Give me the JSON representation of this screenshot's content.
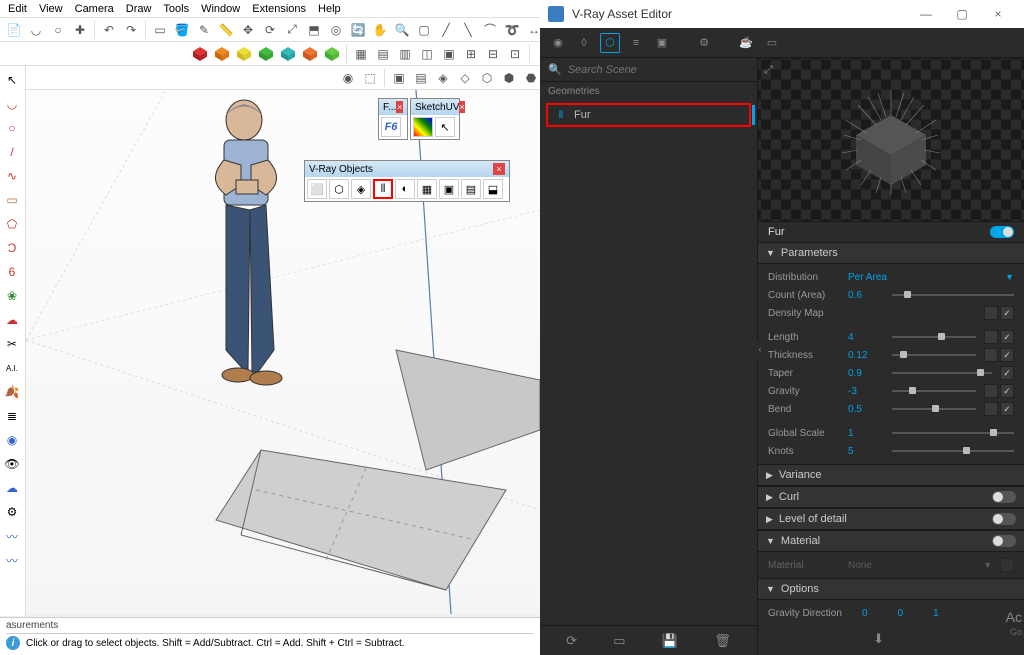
{
  "menu": [
    "Edit",
    "View",
    "Camera",
    "Draw",
    "Tools",
    "Window",
    "Extensions",
    "Help"
  ],
  "float_panels": {
    "fredo": {
      "title": "F..."
    },
    "sketchuv": {
      "title": "SketchUV"
    },
    "vrayobj": {
      "title": "V-Ray Objects",
      "highlight_index": 3
    }
  },
  "statusbar": {
    "measure": "asurements",
    "hint": "Click or drag to select objects. Shift = Add/Subtract. Ctrl = Add. Shift + Ctrl = Subtract."
  },
  "vray": {
    "title": "V-Ray Asset Editor",
    "search_placeholder": "Search Scene",
    "category": "Geometries",
    "tree_item": "Fur",
    "prop_title": "Fur",
    "sections": {
      "parameters": "Parameters",
      "variance": "Variance",
      "curl": "Curl",
      "lod": "Level of detail",
      "material": "Material",
      "options": "Options"
    },
    "params": {
      "distribution": {
        "label": "Distribution",
        "value": "Per Area"
      },
      "count": {
        "label": "Count (Area)",
        "value": "0.6",
        "thumb": 10
      },
      "density": {
        "label": "Density Map"
      },
      "length": {
        "label": "Length",
        "value": "4",
        "thumb": 55
      },
      "thickness": {
        "label": "Thickness",
        "value": "0.12",
        "thumb": 10
      },
      "taper": {
        "label": "Taper",
        "value": "0.9",
        "thumb": 85
      },
      "gravity": {
        "label": "Gravity",
        "value": "-3",
        "thumb": 20
      },
      "bend": {
        "label": "Bend",
        "value": "0.5",
        "thumb": 48
      },
      "globalscale": {
        "label": "Global Scale",
        "value": "1",
        "thumb": 80
      },
      "knots": {
        "label": "Knots",
        "value": "5",
        "thumb": 58
      }
    },
    "material_row": {
      "label": "Material",
      "value": "None"
    },
    "gravity_dir": {
      "label": "Gravity Direction",
      "x": "0",
      "y": "0",
      "z": "1"
    }
  },
  "activate": {
    "title": "Ac",
    "sub": "Go"
  }
}
